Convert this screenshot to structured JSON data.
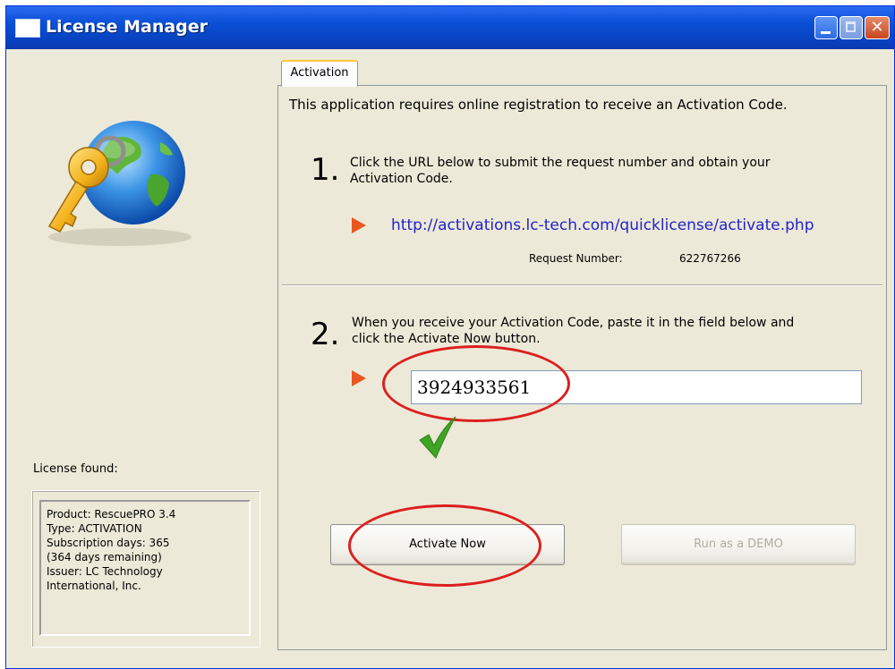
{
  "window": {
    "title": "License Manager",
    "controls": {
      "minimize": "minimize-icon",
      "maximize": "maximize-icon",
      "close": "close-icon"
    }
  },
  "sidebar": {
    "icon": "globe-key-icon",
    "license_found_label": "License found:",
    "license_lines": [
      "Product: RescuePRO 3.4",
      "Type: ACTIVATION",
      "Subscription days: 365",
      "(364 days remaining)",
      "Issuer: LC Technology",
      "International, Inc."
    ]
  },
  "tab": {
    "label": "Activation"
  },
  "intro": "This application requires online registration to receive an Activation Code.",
  "step1": {
    "number": "1.",
    "text_line1": "Click the URL below to submit the request number and obtain your",
    "text_line2": "Activation Code.",
    "url": "http://activations.lc-tech.com/quicklicense/activate.php",
    "request_label": "Request Number:",
    "request_number": "622767266"
  },
  "step2": {
    "number": "2.",
    "text_line1": "When you receive your Activation Code, paste it in the field below and",
    "text_line2": "click the Activate Now button.",
    "activation_code": "3924933561",
    "status_icon": "checkmark-icon"
  },
  "buttons": {
    "activate": "Activate Now",
    "demo": "Run as a DEMO"
  },
  "colors": {
    "titlebar": "#0a4fd6",
    "link": "#2222cc",
    "arrow": "#e8571f",
    "annotation_ring": "#dc1f1f",
    "check": "#3fa524"
  }
}
